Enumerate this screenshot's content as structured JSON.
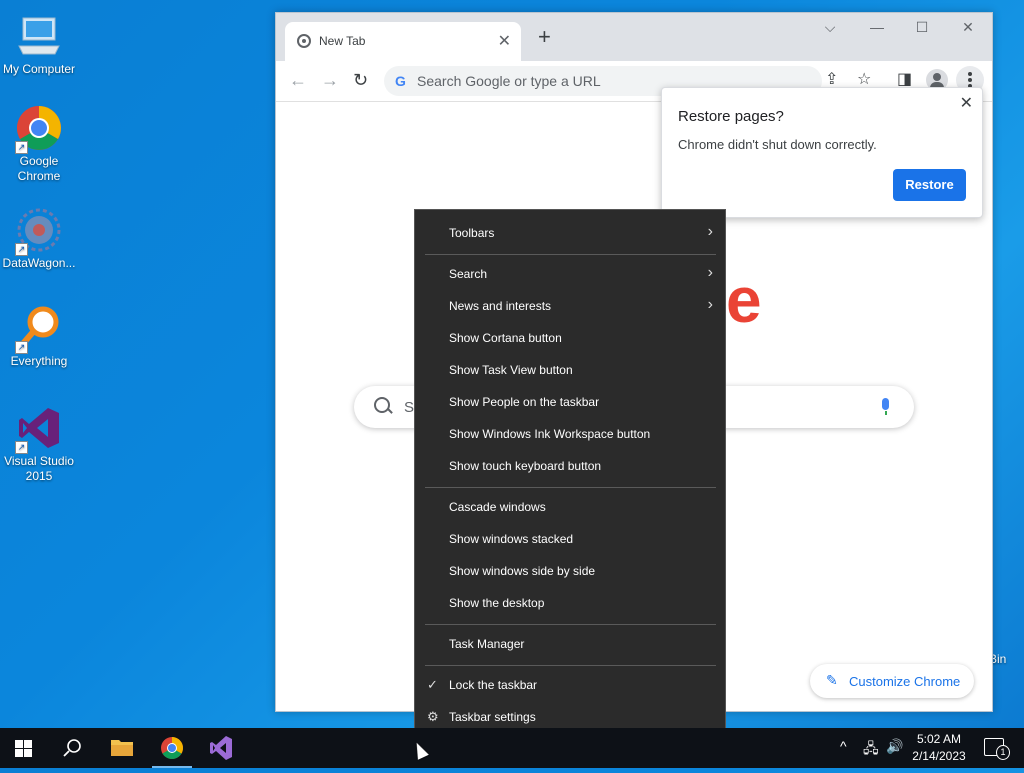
{
  "desktop": {
    "icons": [
      {
        "label": "My Computer",
        "icon": "computer-icon"
      },
      {
        "label": "Google Chrome",
        "icon": "chrome-icon"
      },
      {
        "label": "DataWagon...",
        "icon": "datawagon-icon"
      },
      {
        "label": "Everything",
        "icon": "search-magnifier-icon"
      },
      {
        "label": "Visual Studio 2015",
        "icon": "visual-studio-icon"
      }
    ],
    "recycle_bin_partial": "Bin"
  },
  "chrome": {
    "tab_title": "New Tab",
    "omnibox_placeholder": "Search Google or type a URL",
    "logo_fragment": "e",
    "search_placeholder_fragment": "S",
    "customize_label": "Customize Chrome"
  },
  "restore_popup": {
    "title": "Restore pages?",
    "message": "Chrome didn't shut down correctly.",
    "button": "Restore"
  },
  "context_menu": {
    "items": {
      "toolbars": "Toolbars",
      "search": "Search",
      "news": "News and interests",
      "cortana": "Show Cortana button",
      "task_view": "Show Task View button",
      "people": "Show People on the taskbar",
      "ink": "Show Windows Ink Workspace button",
      "touch_keyboard": "Show touch keyboard button",
      "cascade": "Cascade windows",
      "stacked": "Show windows stacked",
      "side_by_side": "Show windows side by side",
      "desktop": "Show the desktop",
      "task_manager": "Task Manager",
      "lock": "Lock the taskbar",
      "settings": "Taskbar settings"
    }
  },
  "taskbar": {
    "time": "5:02 AM",
    "date": "2/14/2023",
    "notification_count": "1"
  },
  "colors": {
    "accent": "#1a73e8",
    "menu_bg": "#2b2b2b",
    "taskbar_bg": "#0d1117"
  }
}
